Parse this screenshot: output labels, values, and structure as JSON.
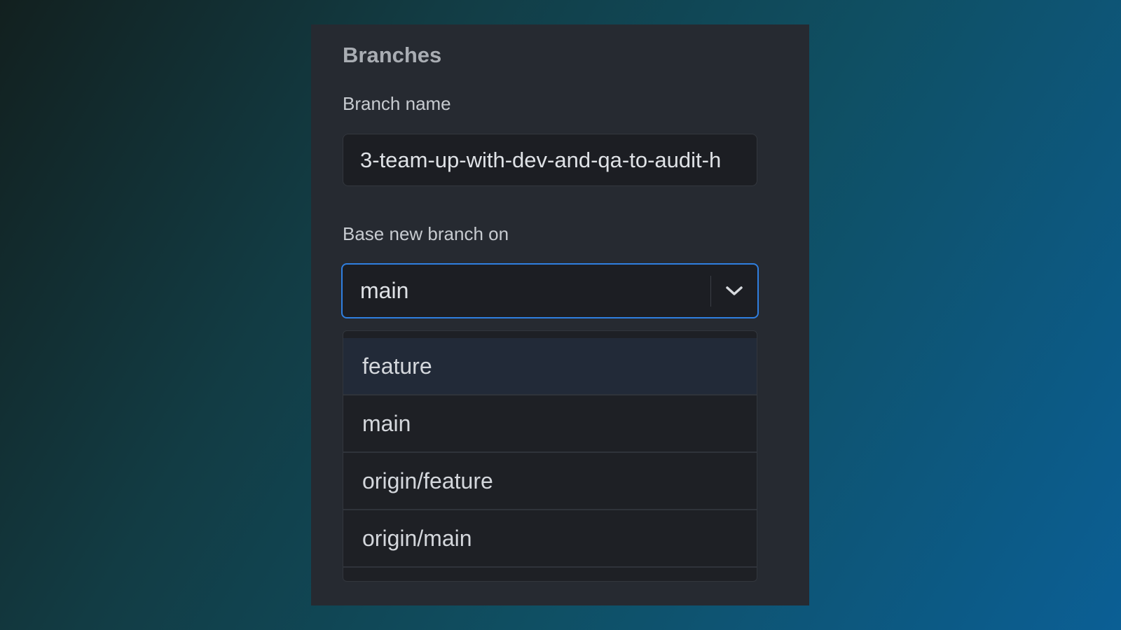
{
  "panel": {
    "title": "Branches",
    "branch_name_label": "Branch name",
    "branch_name_value": "3-team-up-with-dev-and-qa-to-audit-h",
    "base_label": "Base new branch on",
    "base_selected": "main"
  },
  "dropdown": {
    "items": [
      {
        "label": "feature"
      },
      {
        "label": "main"
      },
      {
        "label": "origin/feature"
      },
      {
        "label": "origin/main"
      }
    ]
  },
  "colors": {
    "accent": "#2f7fe0",
    "panel": "#262a31",
    "highlight": "#222a38"
  },
  "icons": {
    "select_toggle": "chevron-down-icon"
  }
}
